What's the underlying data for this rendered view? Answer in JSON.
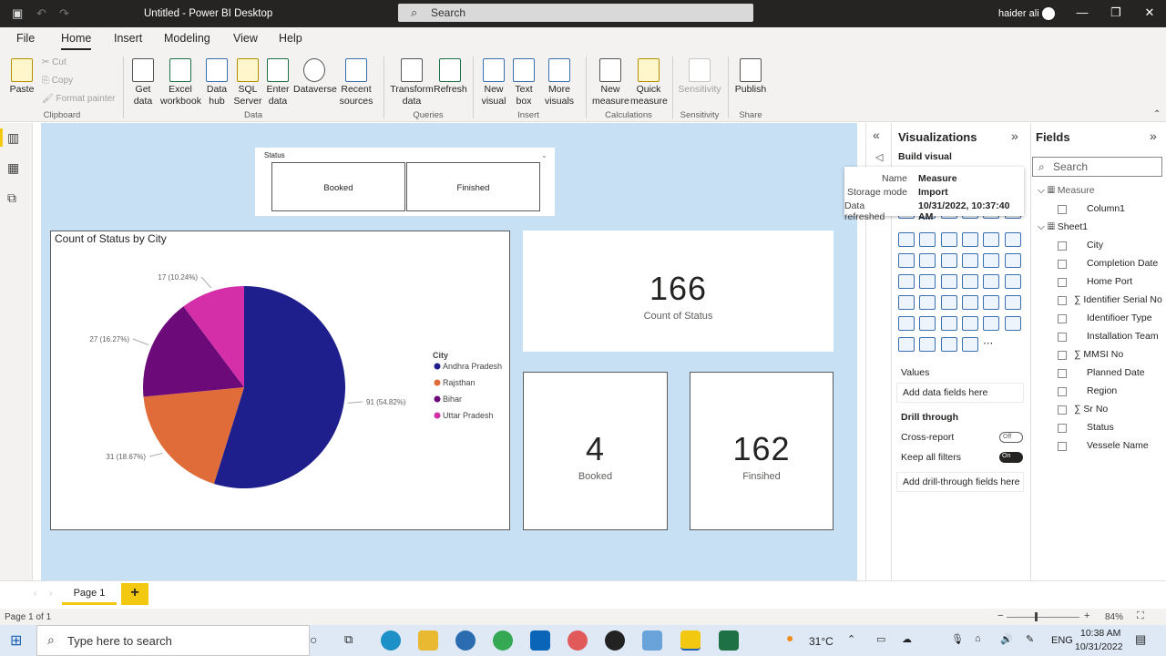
{
  "titlebar": {
    "title": "Untitled - Power BI Desktop",
    "search_placeholder": "Search",
    "user": "haider ali"
  },
  "menu": {
    "tabs": [
      "File",
      "Home",
      "Insert",
      "Modeling",
      "View",
      "Help"
    ]
  },
  "ribbon": {
    "clipboard": {
      "paste": "Paste",
      "cut": "Cut",
      "copy": "Copy",
      "format_painter": "Format painter",
      "group": "Clipboard"
    },
    "data": {
      "get_data": "Get data",
      "excel": "Excel workbook",
      "data_hub": "Data hub",
      "sql": "SQL Server",
      "enter_data": "Enter data",
      "dataverse": "Dataverse",
      "recent": "Recent sources",
      "group": "Data"
    },
    "queries": {
      "transform": "Transform data",
      "refresh": "Refresh",
      "group": "Queries"
    },
    "insert": {
      "new_visual": "New visual",
      "text_box": "Text box",
      "more_visuals": "More visuals",
      "group": "Insert"
    },
    "calculations": {
      "new_measure": "New measure",
      "quick_measure": "Quick measure",
      "group": "Calculations"
    },
    "sensitivity": {
      "label": "Sensitivity",
      "group": "Sensitivity"
    },
    "share": {
      "publish": "Publish",
      "group": "Share"
    }
  },
  "slicer": {
    "title": "Status",
    "options": [
      "Booked",
      "Finished"
    ]
  },
  "chart_data": {
    "type": "pie",
    "title": "Count of Status by City",
    "legend_title": "City",
    "legend_position": "right",
    "categories": [
      "Andhra Pradesh",
      "Rajsthan",
      "Bihar",
      "Uttar Pradesh"
    ],
    "values": [
      91,
      31,
      27,
      17
    ],
    "labels": [
      "91 (54.82%)",
      "31 (18.67%)",
      "27 (16.27%)",
      "17 (10.24%)"
    ],
    "colors": [
      "#1e1e8c",
      "#e06c3a",
      "#6b0a78",
      "#d42fa8"
    ]
  },
  "kpis": {
    "total": {
      "value": "166",
      "label": "Count of Status"
    },
    "booked": {
      "value": "4",
      "label": "Booked"
    },
    "finished": {
      "value": "162",
      "label": "Finsihed"
    }
  },
  "viz_pane": {
    "title": "Visualizations",
    "build_visual": "Build visual",
    "values_label": "Values",
    "values_placeholder": "Add data fields here",
    "drill_through": "Drill through",
    "cross_report": "Cross-report",
    "cross_report_state": "Off",
    "keep_filters": "Keep all filters",
    "keep_filters_state": "On",
    "drill_placeholder": "Add drill-through fields here"
  },
  "tooltip": {
    "name_label": "Name",
    "name_value": "Measure",
    "storage_label": "Storage mode",
    "storage_value": "Import",
    "refreshed_label": "Data refreshed",
    "refreshed_value": "10/31/2022, 10:37:40 AM"
  },
  "fields_pane": {
    "title": "Fields",
    "search_placeholder": "Search",
    "tables": [
      {
        "name": "Measure",
        "fields": [
          "Column1"
        ]
      },
      {
        "name": "Sheet1",
        "fields": [
          "City",
          "Completion Date",
          "Home Port",
          "Identifier Serial No",
          "Identifioer Type",
          "Installation Team",
          "MMSI No",
          "Planned Date",
          "Region",
          "Sr No",
          "Status",
          "Vessele Name"
        ]
      }
    ]
  },
  "pages": {
    "tab": "Page 1",
    "add": "+"
  },
  "status": {
    "page_info": "Page 1 of 1",
    "zoom": "84%"
  },
  "taskbar": {
    "search_placeholder": "Type here to search",
    "temperature": "31°C",
    "lang": "ENG",
    "time": "10:38 AM",
    "date": "10/31/2022"
  }
}
